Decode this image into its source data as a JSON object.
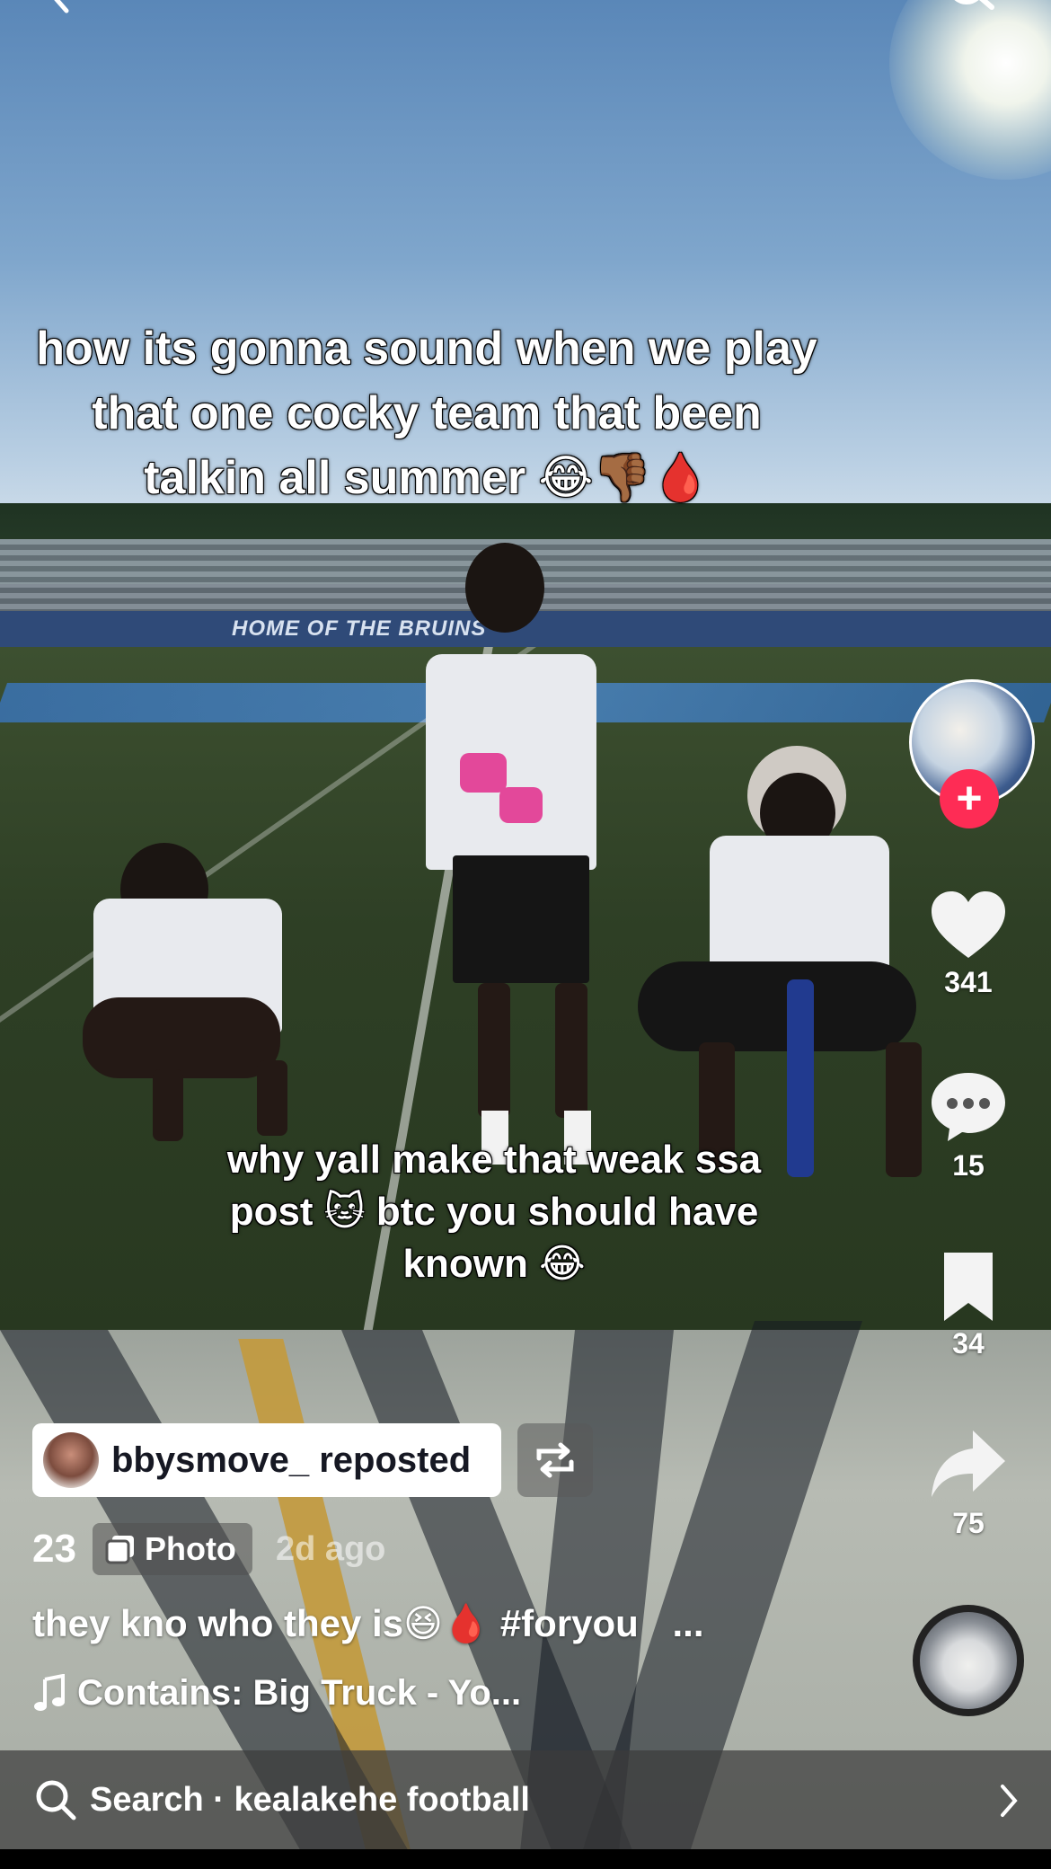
{
  "overlay_caption_top": "how its gonna sound when we play that one cocky team that been talkin all summer 😂👎🏾🩸",
  "overlay_caption_mid": "why yall make that weak ssa post 🐱 btc you should have known 😂",
  "stadium_banner": "HOME OF THE BRUINS",
  "actions": {
    "likes": "341",
    "comments": "15",
    "saves": "34",
    "shares": "75"
  },
  "repost": {
    "label": "bbysmove_ reposted"
  },
  "post": {
    "photo_count": "23",
    "type_label": "Photo",
    "time_ago": "2d ago",
    "description": "they kno who they is😆🩸 #foryou",
    "more_label": "...",
    "music": "Contains: Big Truck - Yo..."
  },
  "search": {
    "label": "Search · kealakehe football"
  },
  "icons": [
    "back-arrow-icon",
    "search-icon",
    "plus-icon",
    "heart-icon",
    "comment-icon",
    "bookmark-icon",
    "share-icon",
    "repost-icon",
    "photo-icon",
    "music-note-icon",
    "search-icon",
    "chevron-right-icon"
  ],
  "colors": {
    "follow": "#fe2c55",
    "pill_bg": "#ffffff",
    "pill_text": "#161823"
  }
}
